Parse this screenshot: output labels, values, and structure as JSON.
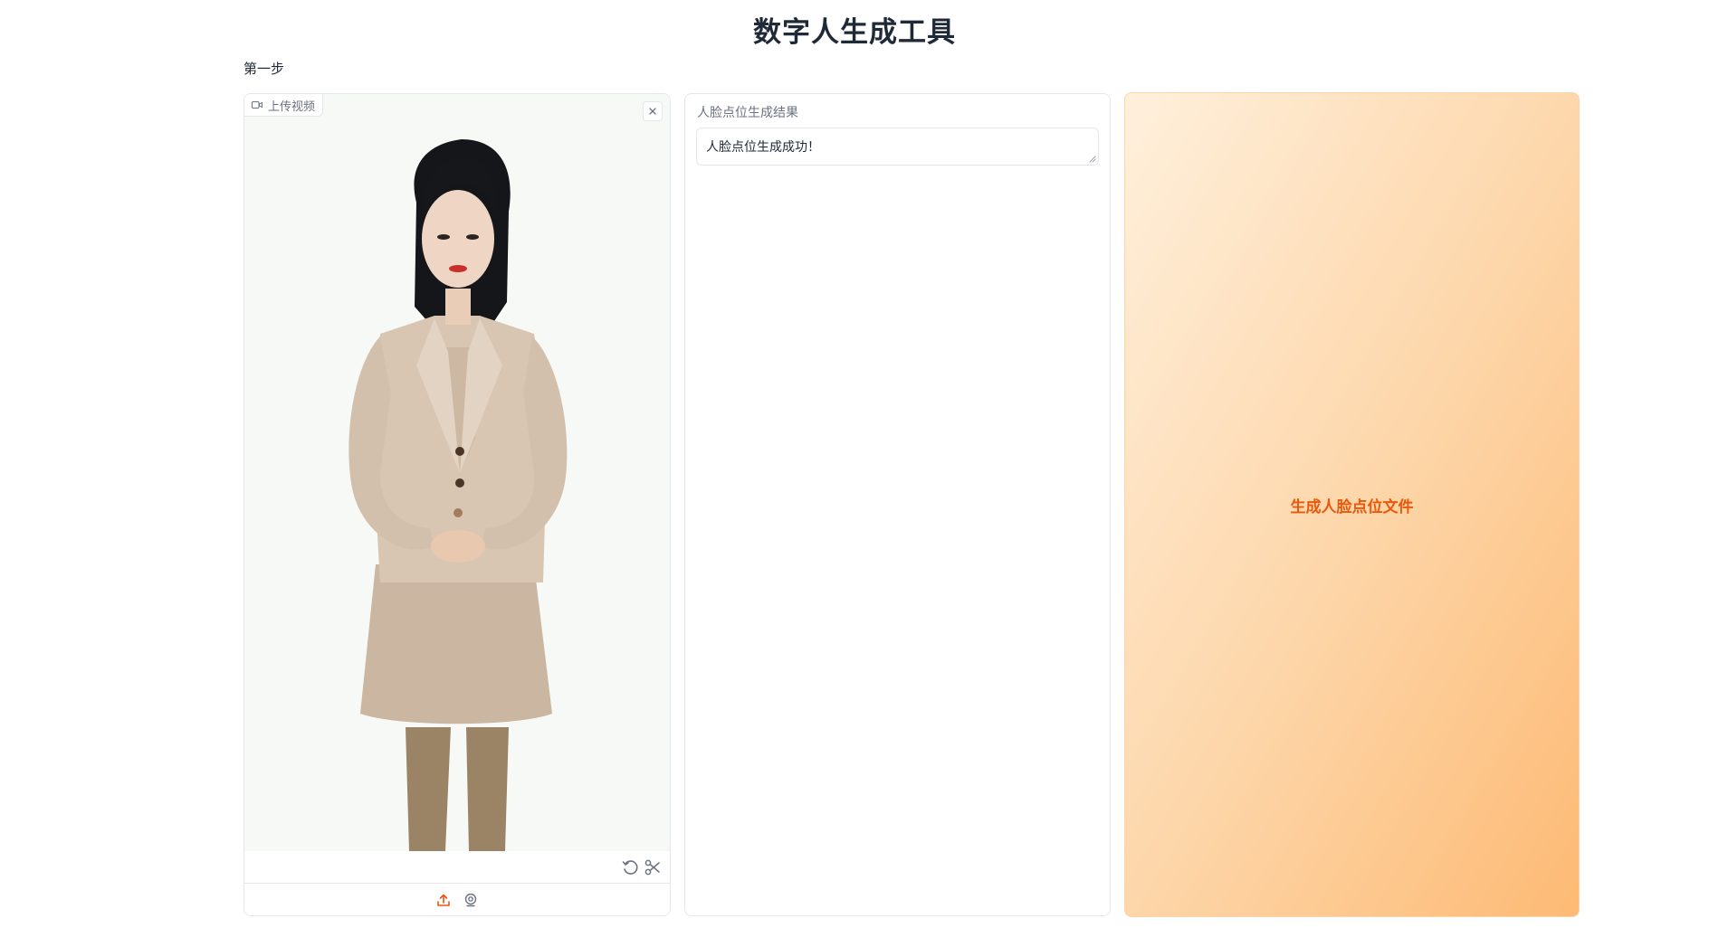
{
  "page": {
    "title": "数字人生成工具",
    "step_label": "第一步"
  },
  "video_upload": {
    "tag_label": "上传视频",
    "icons": {
      "tag": "video-icon",
      "close": "close-icon",
      "undo": "undo-icon",
      "trim": "scissors-icon",
      "upload": "upload-icon",
      "webcam": "webcam-icon"
    }
  },
  "result": {
    "label": "人脸点位生成结果",
    "value": "人脸点位生成成功！"
  },
  "action": {
    "generate_label": "生成人脸点位文件"
  },
  "colors": {
    "accent": "#ea580c",
    "button_gradient_start": "#fff0dc",
    "button_gradient_end": "#fdba74"
  }
}
